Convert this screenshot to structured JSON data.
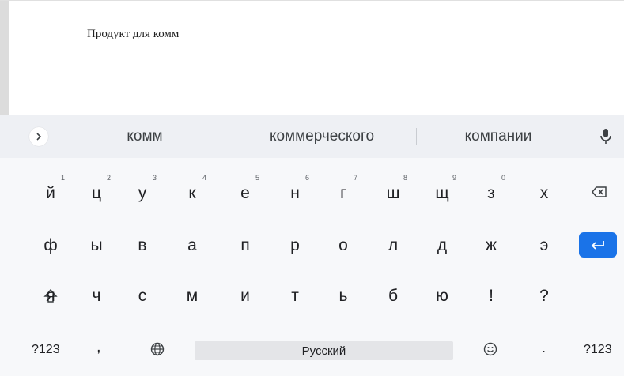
{
  "document": {
    "text": "Продукт для комм"
  },
  "suggestions": {
    "words": [
      "комм",
      "коммерческого",
      "компании"
    ],
    "expand_icon": "chevron-right-icon",
    "mic_icon": "mic-icon"
  },
  "keyboard": {
    "row1": [
      "й",
      "ц",
      "у",
      "к",
      "е",
      "н",
      "г",
      "ш",
      "щ",
      "з",
      "х"
    ],
    "row1_hints": [
      "1",
      "2",
      "3",
      "4",
      "5",
      "6",
      "7",
      "8",
      "9",
      "0"
    ],
    "row2": [
      "ф",
      "ы",
      "в",
      "а",
      "п",
      "р",
      "о",
      "л",
      "д",
      "ж",
      "э"
    ],
    "row3": [
      "я",
      "ч",
      "с",
      "м",
      "и",
      "т",
      "ь",
      "б",
      "ю",
      "!",
      "?"
    ],
    "symbols_left": "?123",
    "comma": ",",
    "space_label": "Русский",
    "period": ".",
    "symbols_right": "?123",
    "accent_color": "#1a73e8"
  }
}
